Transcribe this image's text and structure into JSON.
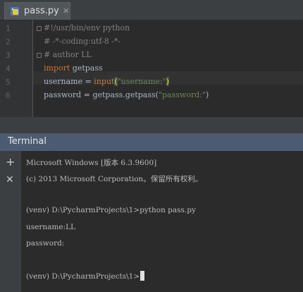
{
  "tab": {
    "filename": "pass.py",
    "close_glyph": "✕",
    "icon": "python-file-icon"
  },
  "editor": {
    "line_numbers": [
      "1",
      "2",
      "3",
      "4",
      "5",
      "6"
    ],
    "lines": {
      "l1": "#!/usr/bin/env python",
      "l2": "# -*-coding:utf-8 -*-",
      "l3": "# author LL",
      "l4_kw": "import",
      "l4_rest": " getpass",
      "l5_a": "username = ",
      "l5_fn": "input",
      "l5_open": "(",
      "l5_str": "\"username:\"",
      "l5_close": ")",
      "l6_a": "password = getpass.getpass(",
      "l6_str": "\"password:\"",
      "l6_close": ")"
    }
  },
  "terminal": {
    "title": "Terminal",
    "add_glyph": "+",
    "close_glyph": "✕",
    "lines": {
      "t1": "Microsoft Windows [版本 6.3.9600]",
      "t2": "(c) 2013 Microsoft Corporation。保留所有权利。",
      "t3": "(venv) D:\\PycharmProjects\\1>python pass.py",
      "t4": "username:LL",
      "t5": "password:",
      "t6": "(venv) D:\\PycharmProjects\\1>"
    }
  },
  "colors": {
    "editor_bg": "#2b2b2b",
    "keyword": "#cc7832",
    "string": "#6a8759",
    "comment": "#808080",
    "terminal_header": "#4b5c72"
  }
}
